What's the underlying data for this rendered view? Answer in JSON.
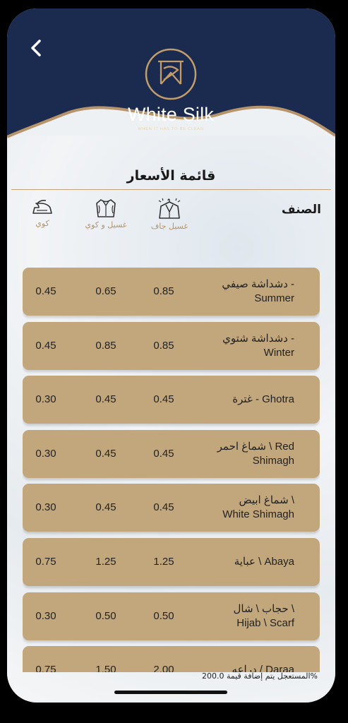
{
  "colors": {
    "navy": "#1b2a4f",
    "gold": "#c2a77c",
    "accent_gold": "#b8946a"
  },
  "header": {
    "back_icon": "chevron-left-icon",
    "brand_first": "White",
    "brand_second": "Silk",
    "tagline": "WHEN IT HAS TO BE CLEAN"
  },
  "page_title": "قائمة الأسعار",
  "columns": {
    "category_label": "الصنف",
    "dry_clean": {
      "label": "غسيل جاف",
      "icon": "suit-icon"
    },
    "wash_iron": {
      "label": "غسيل و كوي",
      "icon": "shirt-icon"
    },
    "iron": {
      "label": "كوي",
      "icon": "iron-icon"
    }
  },
  "items": [
    {
      "name_line1": "دشداشة صيفي -",
      "name_line2": "Summer",
      "dry": "0.85",
      "wash": "0.65",
      "iron": "0.45"
    },
    {
      "name_line1": "دشداشة شتوي -",
      "name_line2": "Winter",
      "dry": "0.85",
      "wash": "0.85",
      "iron": "0.45"
    },
    {
      "name_line1": "غترة - Ghotra",
      "name_line2": "",
      "dry": "0.45",
      "wash": "0.45",
      "iron": "0.30"
    },
    {
      "name_line1": "شماغ احمر \\ Red",
      "name_line2": "Shimagh",
      "dry": "0.45",
      "wash": "0.45",
      "iron": "0.30"
    },
    {
      "name_line1": "شماغ ابيض \\",
      "name_line2": "White Shimagh",
      "dry": "0.45",
      "wash": "0.45",
      "iron": "0.30"
    },
    {
      "name_line1": "عباية \\ Abaya",
      "name_line2": "",
      "dry": "1.25",
      "wash": "1.25",
      "iron": "0.75"
    },
    {
      "name_line1": "حجاب \\ شال \\",
      "name_line2": "Hijab \\ Scarf",
      "dry": "0.50",
      "wash": "0.50",
      "iron": "0.30"
    },
    {
      "name_line1": "دراعه / Daraa",
      "name_line2": "",
      "dry": "2.00",
      "wash": "1.50",
      "iron": "0.75"
    }
  ],
  "footer_note": "المستعجل يتم إضافة قيمة 200.0%"
}
